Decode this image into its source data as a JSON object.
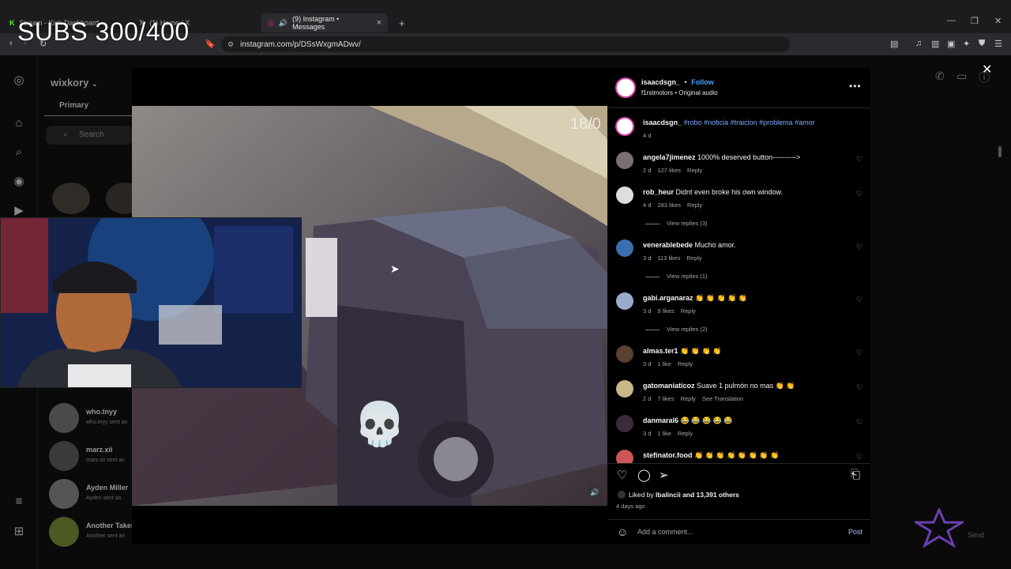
{
  "browser": {
    "tabs": [
      {
        "label": "Stream - Kick Dashboard"
      },
      {
        "label": "(1) Home / X"
      },
      {
        "label": "(9) Instagram • Messages"
      }
    ],
    "url": "instagram.com/p/DSsWxgmADwv/"
  },
  "overlay": {
    "subs_counter": "SUBS 300/400"
  },
  "instagram_bg": {
    "account": "wixkory",
    "tab_primary": "Primary",
    "search_placeholder": "Search",
    "dm_threads": [
      {
        "name": "who.tnyy",
        "preview": "who.tnyy sent an"
      },
      {
        "name": "marz.xii",
        "preview": "marz.xii sent an"
      },
      {
        "name": "Ayden Miller",
        "preview": "Ayden sent an"
      },
      {
        "name": "Another Taker",
        "preview": "Another sent an"
      }
    ],
    "send_label": "Send"
  },
  "post": {
    "author": "isaacdsgn_",
    "follow_label": "Follow",
    "dot": "•",
    "audio": "f1rstmotors • Original audio",
    "caption": {
      "user": "isaacdsgn_",
      "text": "#robo #noticia #traicion #problema #amor",
      "age": "4 d"
    },
    "comments": [
      {
        "user": "angela7jimenez",
        "text": "1000% deserved button---------->",
        "age": "2 d",
        "likes": "127 likes",
        "reply": "Reply"
      },
      {
        "user": "rob_heur",
        "text": "Didnt even broke his own window.",
        "age": "4 d",
        "likes": "283 likes",
        "reply": "Reply",
        "view_replies": "View replies (3)"
      },
      {
        "user": "venerablebede",
        "text": "Mucho amor.",
        "age": "3 d",
        "likes": "113 likes",
        "reply": "Reply",
        "view_replies": "View replies (1)"
      },
      {
        "user": "gabi.arganaraz",
        "text": "👏 👏 👏 👏 👏",
        "age": "3 d",
        "likes": "9 likes",
        "reply": "Reply",
        "view_replies": "View replies (2)"
      },
      {
        "user": "almas.ter1",
        "text": "👏 👏 👏 👏",
        "age": "3 d",
        "likes": "1 like",
        "reply": "Reply"
      },
      {
        "user": "gatomaniaticoz",
        "text": "Suave 1 pulmón no mas 👏 👏",
        "age": "2 d",
        "likes": "7 likes",
        "reply": "Reply",
        "translate": "See Translation"
      },
      {
        "user": "danmaral6",
        "text": "😂 😂 😂 😂 😂",
        "age": "3 d",
        "likes": "1 like",
        "reply": "Reply"
      },
      {
        "user": "stefinator.food",
        "text": "👏 👏 👏 👏 👏 👏 👏 👏",
        "age": "",
        "likes": "",
        "reply": ""
      }
    ],
    "liked_by_user": "lbalincii",
    "liked_by_rest": "and 13,391 others",
    "liked_prefix": "Liked by",
    "posted_ago": "4 days ago",
    "add_comment_placeholder": "Add a comment...",
    "post_label": "Post",
    "video_timestamp": "18/0"
  },
  "colors": {
    "follow": "#4aa3ff",
    "hashtag": "#7ea9ff",
    "panel_bg": "#000000"
  }
}
